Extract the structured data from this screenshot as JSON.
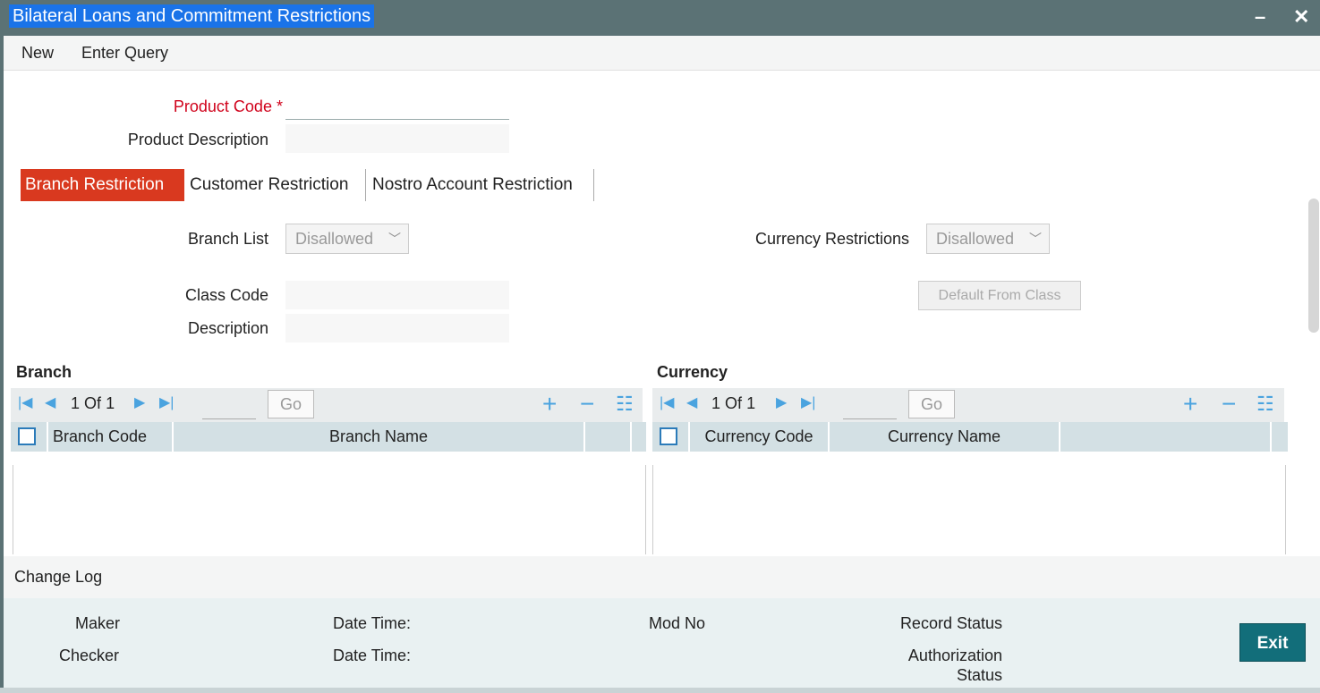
{
  "window": {
    "title": "Bilateral Loans and Commitment Restrictions",
    "minimize": "–",
    "close": "✕"
  },
  "menu": {
    "new": "New",
    "enter_query": "Enter Query"
  },
  "form": {
    "product_code_label": "Product Code",
    "required_mark": "*",
    "product_code_value": "",
    "product_description_label": "Product Description",
    "product_description_value": ""
  },
  "tabs": [
    "Branch Restriction",
    "Customer Restriction",
    "Nostro Account Restriction"
  ],
  "branch_tab": {
    "branch_list_label": "Branch List",
    "branch_list_value": "Disallowed",
    "currency_restrictions_label": "Currency Restrictions",
    "currency_restrictions_value": "Disallowed",
    "class_code_label": "Class Code",
    "class_code_value": "",
    "description_label": "Description",
    "description_value": "",
    "default_from_class": "Default From Class"
  },
  "branch_grid": {
    "title": "Branch",
    "page": "1",
    "of": "Of",
    "total": "1",
    "go": "Go",
    "columns": [
      "Branch Code",
      "Branch Name"
    ],
    "rows": []
  },
  "currency_grid": {
    "title": "Currency",
    "page": "1",
    "of": "Of",
    "total": "1",
    "go": "Go",
    "columns": [
      "Currency Code",
      "Currency Name"
    ],
    "rows": []
  },
  "change_log": {
    "title": "Change Log"
  },
  "footer": {
    "maker": "Maker",
    "checker": "Checker",
    "date_time_1": "Date Time:",
    "date_time_2": "Date Time:",
    "mod_no": "Mod No",
    "record_status": "Record Status",
    "authorization": "Authorization",
    "status": "Status",
    "exit": "Exit"
  },
  "colors": {
    "titlebar": "#5b7275",
    "title_highlight": "#1a73e8",
    "active_tab": "#d9391f",
    "required": "#d0021b",
    "icon": "#4aa3df",
    "exit_button": "#126e7a"
  },
  "icons": {
    "first": "first-page-icon",
    "prev": "prev-page-icon",
    "next": "next-page-icon",
    "last": "last-page-icon",
    "add": "add-row-icon",
    "remove": "remove-row-icon",
    "columns": "list-icon"
  }
}
